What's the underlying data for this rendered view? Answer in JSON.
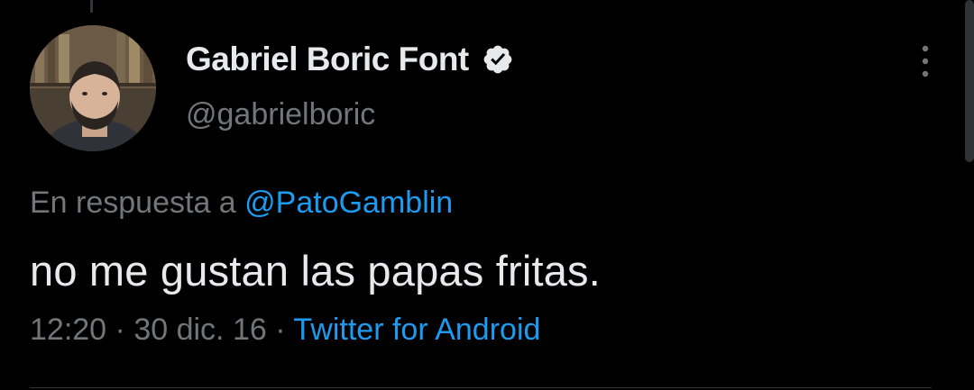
{
  "tweet": {
    "author": {
      "display_name": "Gabriel Boric Font",
      "handle": "@gabrielboric",
      "verified": true,
      "avatar_icon": "user-avatar-photo"
    },
    "reply_to": {
      "prefix": "En respuesta a",
      "mention": "@PatoGamblin"
    },
    "text": "no me gustan las papas fritas.",
    "meta": {
      "time": "12:20",
      "separator": "·",
      "date": "30 dic. 16",
      "source": "Twitter for Android"
    },
    "more_icon": "more-vertical-icon"
  },
  "colors": {
    "background": "#000000",
    "primary_text": "#e7e9ea",
    "secondary_text": "#71767b",
    "accent": "#1d9bf0",
    "divider": "#2f3336"
  }
}
